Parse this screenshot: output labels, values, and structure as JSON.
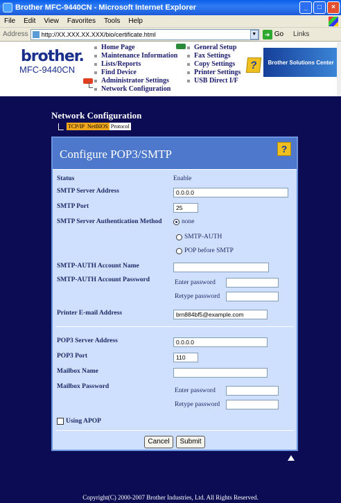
{
  "window": {
    "title": "Brother MFC-9440CN - Microsoft Internet Explorer"
  },
  "menubar": [
    "File",
    "Edit",
    "View",
    "Favorites",
    "Tools",
    "Help"
  ],
  "addressbar": {
    "label": "Address",
    "url": "http://XX.XXX.XX.XXX/bio/certificate.html",
    "go": "Go",
    "links": "Links"
  },
  "header": {
    "logo": "brother.",
    "model": "MFC-9440CN",
    "nav_left": [
      "Home Page",
      "Maintenance Information",
      "Lists/Reports",
      "Find Device",
      "Administrator Settings",
      "Network Configuration"
    ],
    "nav_right": [
      "General Setup",
      "Fax Settings",
      "Copy Settings",
      "Printer Settings",
      "USB Direct I/F"
    ],
    "solutions": "Brother Solutions Center"
  },
  "section": {
    "title": "Network Configuration",
    "tabs": [
      "TCP/IP",
      "NetBIOS",
      "Protocol"
    ]
  },
  "form": {
    "title": "Configure POP3/SMTP",
    "status_label": "Status",
    "status_value": "Enable",
    "smtp_address_label": "SMTP Server Address",
    "smtp_address_value": "0.0.0.0",
    "smtp_port_label": "SMTP Port",
    "smtp_port_value": "25",
    "auth_method_label": "SMTP Server Authentication Method",
    "auth_options": [
      "none",
      "SMTP-AUTH",
      "POP before SMTP"
    ],
    "auth_selected": "none",
    "auth_account_name_label": "SMTP-AUTH Account Name",
    "auth_account_name_value": "",
    "auth_account_pw_label": "SMTP-AUTH Account Password",
    "enter_password": "Enter password",
    "retype_password": "Retype password",
    "email_label": "Printer E-mail Address",
    "email_value": "brn884bf5@example.com",
    "pop3_address_label": "POP3 Server Address",
    "pop3_address_value": "0.0.0.0",
    "pop3_port_label": "POP3 Port",
    "pop3_port_value": "110",
    "mailbox_name_label": "Mailbox Name",
    "mailbox_name_value": "",
    "mailbox_pw_label": "Mailbox Password",
    "apop_label": "Using APOP",
    "cancel": "Cancel",
    "submit": "Submit"
  },
  "footer": {
    "copyright": "Copyright(C) 2000-2007 Brother Industries, Ltd. All Rights Reserved."
  }
}
